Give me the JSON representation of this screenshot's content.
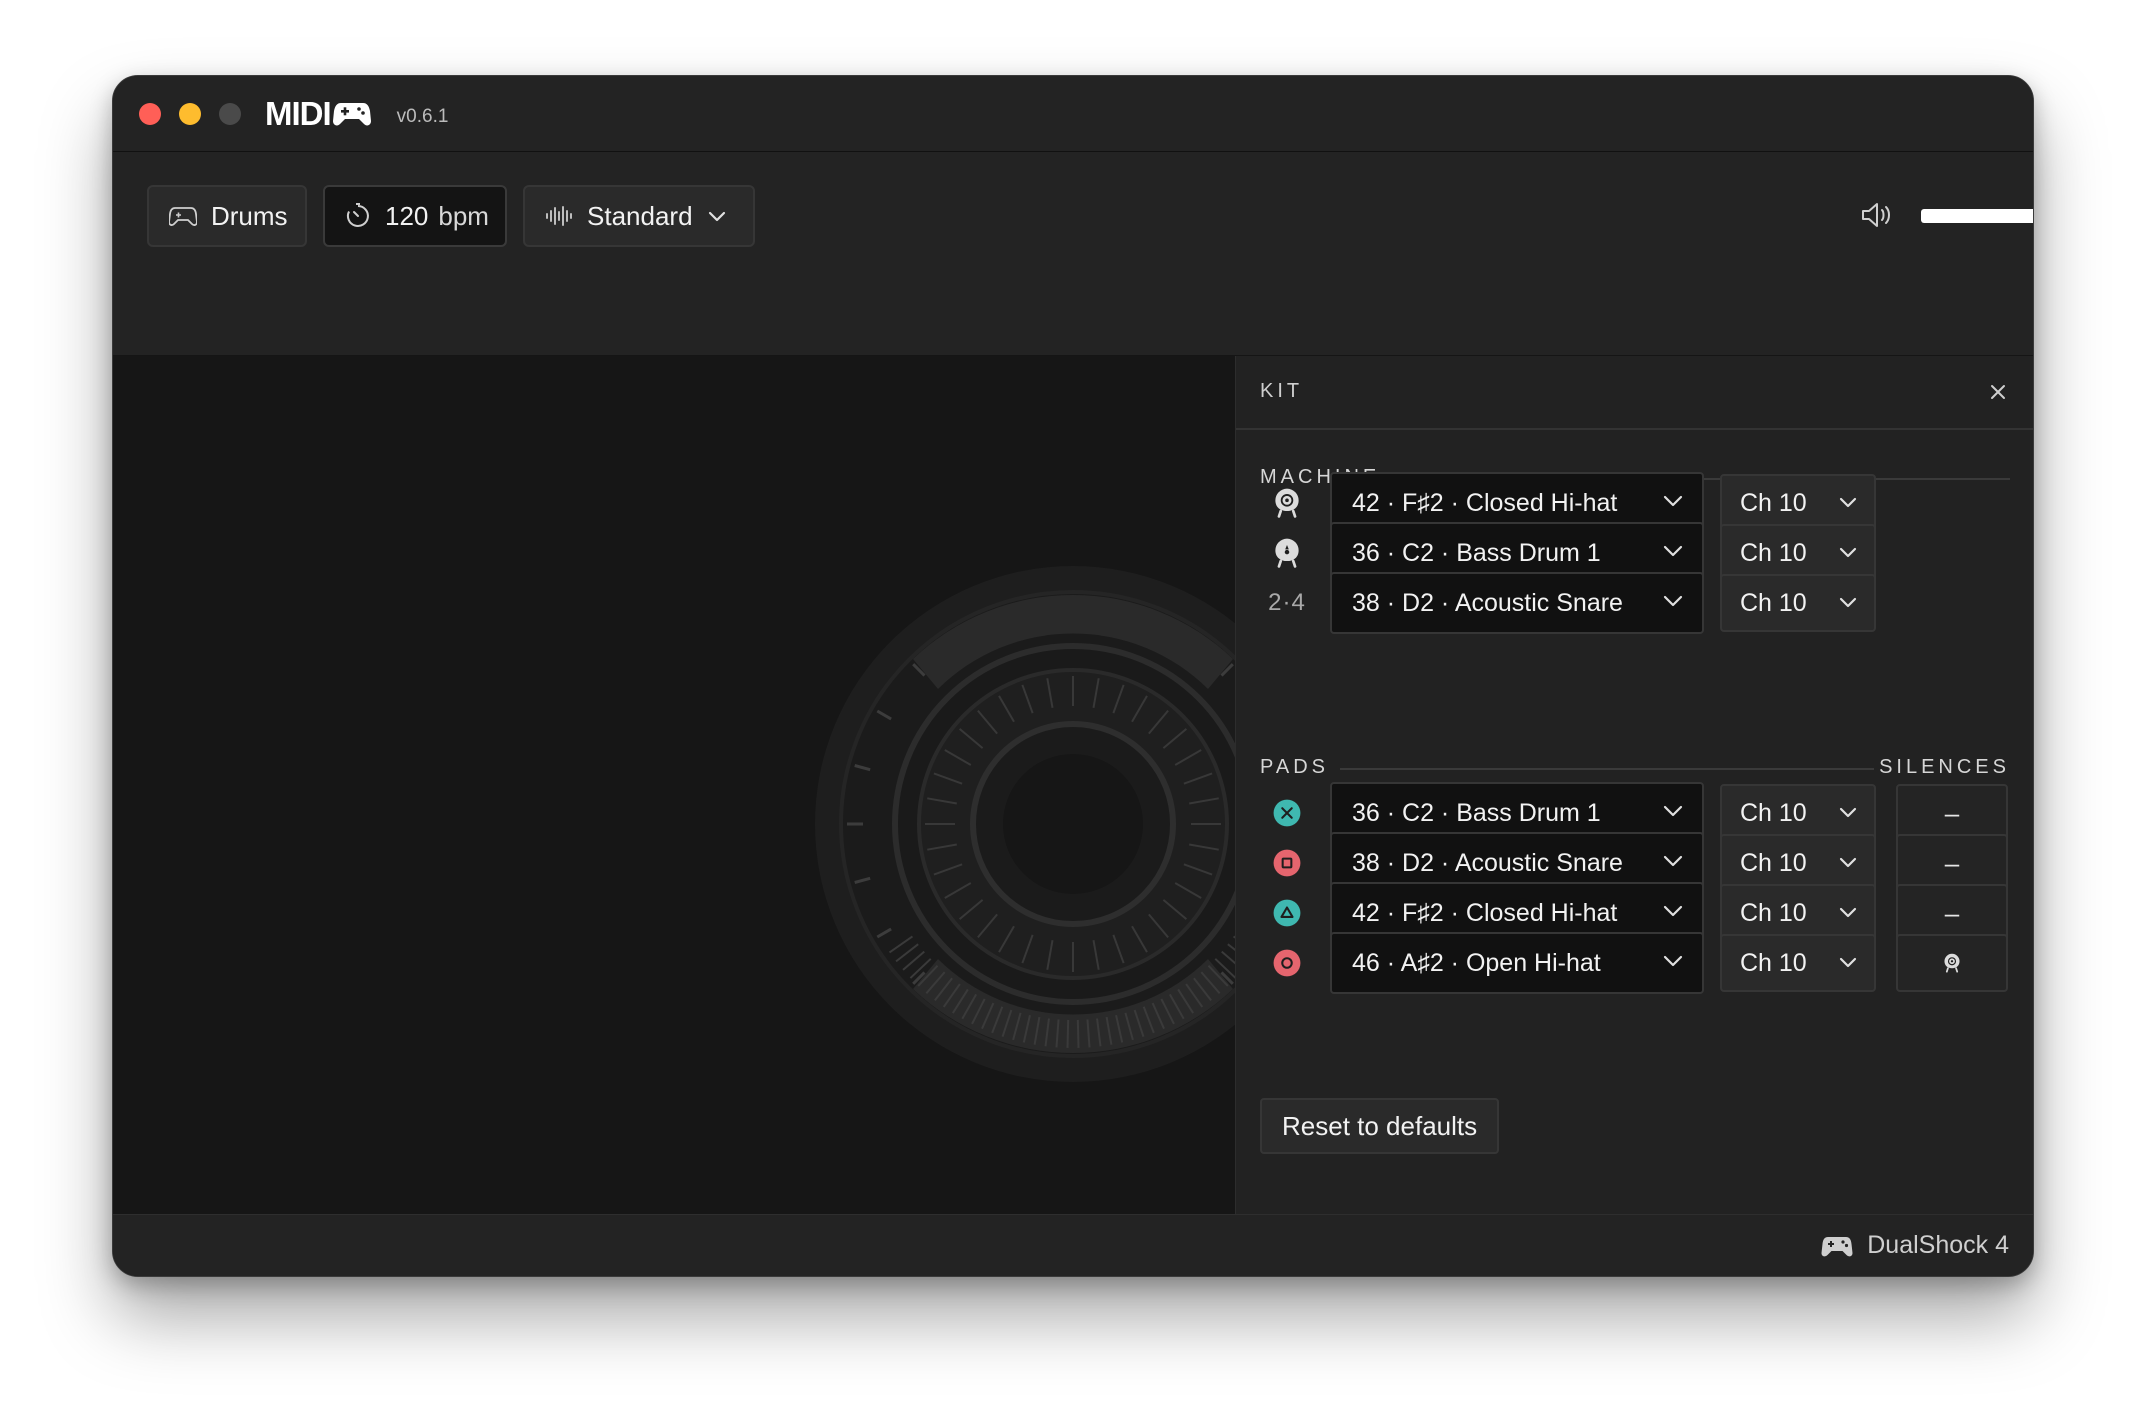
{
  "window": {
    "app_name": "MIDI",
    "version": "v0.6.1"
  },
  "toolbar": {
    "mode_label": "Drums",
    "tempo_value": "120",
    "tempo_unit": "bpm",
    "preset_label": "Standard",
    "volume_level": 0.78
  },
  "kit_panel": {
    "title": "KIT",
    "machine_label": "MACHINE",
    "pads_label": "PADS",
    "silences_label": "SILENCES",
    "machine_rows": [
      {
        "icon": "gyro-sensor-icon",
        "note": "42 · F♯2 · Closed Hi-hat",
        "channel": "Ch 10"
      },
      {
        "icon": "touchpad-sensor-icon",
        "note": "36 · C2 · Bass Drum 1",
        "channel": "Ch 10"
      },
      {
        "icon_text": "2·4",
        "note": "38 · D2 · Acoustic Snare",
        "channel": "Ch 10"
      }
    ],
    "pad_rows": [
      {
        "icon": "cross-button-icon",
        "note": "36 · C2 · Bass Drum 1",
        "channel": "Ch 10",
        "silence": "–"
      },
      {
        "icon": "square-button-icon",
        "note": "38 · D2 · Acoustic Snare",
        "channel": "Ch 10",
        "silence": "–"
      },
      {
        "icon": "triangle-button-icon",
        "note": "42 · F♯2 · Closed Hi-hat",
        "channel": "Ch 10",
        "silence": "–"
      },
      {
        "icon": "circle-button-icon",
        "note": "46 · A♯2 · Open Hi-hat",
        "channel": "Ch 10",
        "silence": ""
      }
    ],
    "reset_label": "Reset to defaults"
  },
  "status": {
    "device": "DualShock 4"
  },
  "colors": {
    "cross": "#3fb8b0",
    "square": "#e5656e",
    "triangle": "#3fb8b0",
    "circle": "#e5656e",
    "traffic_red": "#ff5f57",
    "traffic_yellow": "#febc2e",
    "traffic_inactive": "#4a4a4a"
  }
}
